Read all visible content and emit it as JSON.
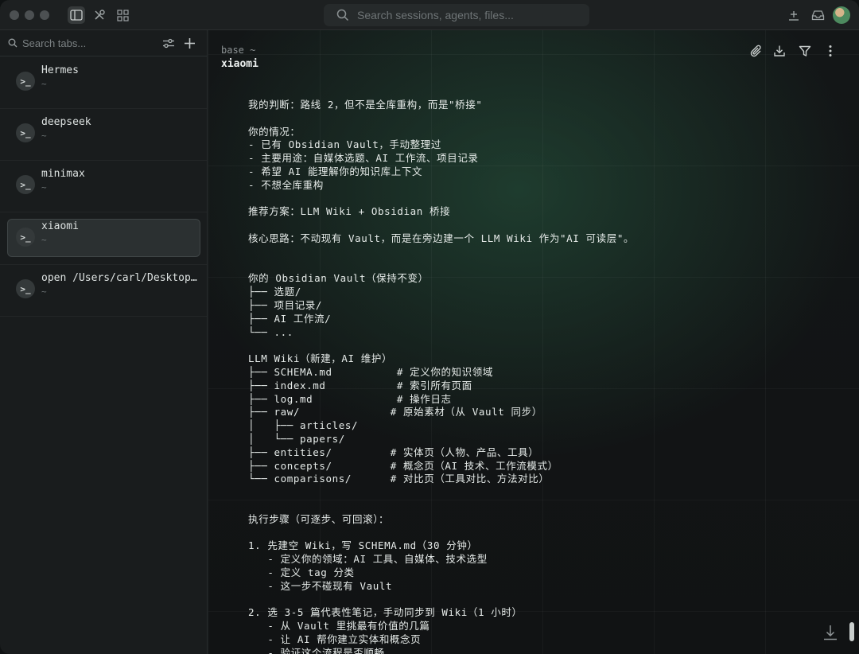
{
  "titlebar": {
    "search_placeholder": "Search sessions, agents, files..."
  },
  "sidebar": {
    "search_placeholder": "Search tabs...",
    "sessions": [
      {
        "name": "Hermes",
        "sub": "~",
        "icon": ">_"
      },
      {
        "name": "deepseek",
        "sub": "~",
        "icon": ">_"
      },
      {
        "name": "minimax",
        "sub": "~",
        "icon": ">_"
      },
      {
        "name": "xiaomi",
        "sub": "~",
        "icon": ">_",
        "active": true
      },
      {
        "name": "open /Users/carl/Desktop…",
        "sub": "~",
        "icon": ">_"
      }
    ]
  },
  "main": {
    "path": "base ~",
    "title": "xiaomi",
    "content_lines": [
      "我的判断：路线 2，但不是全库重构，而是\"桥接\"",
      "",
      "你的情况：",
      "- 已有 Obsidian Vault，手动整理过",
      "- 主要用途：自媒体选题、AI 工作流、项目记录",
      "- 希望 AI 能理解你的知识库上下文",
      "- 不想全库重构",
      "",
      "推荐方案：LLM Wiki + Obsidian 桥接",
      "",
      "核心思路：不动现有 Vault，而是在旁边建一个 LLM Wiki 作为\"AI 可读层\"。",
      "",
      "",
      "你的 Obsidian Vault（保持不变）",
      "├── 选题/",
      "├── 项目记录/",
      "├── AI 工作流/",
      "└── ...",
      "",
      "LLM Wiki（新建，AI 维护）",
      "├── SCHEMA.md          # 定义你的知识领域",
      "├── index.md           # 索引所有页面",
      "├── log.md             # 操作日志",
      "├── raw/              # 原始素材（从 Vault 同步）",
      "│   ├── articles/",
      "│   └── papers/",
      "├── entities/         # 实体页（人物、产品、工具）",
      "├── concepts/         # 概念页（AI 技术、工作流模式）",
      "└── comparisons/      # 对比页（工具对比、方法对比）",
      "",
      "",
      "执行步骤（可逐步、可回滚）：",
      "",
      "1. 先建空 Wiki，写 SCHEMA.md（30 分钟）",
      "   - 定义你的领域：AI 工具、自媒体、技术选型",
      "   - 定义 tag 分类",
      "   - 这一步不碰现有 Vault",
      "",
      "2. 选 3-5 篇代表性笔记，手动同步到 Wiki（1 小时）",
      "   - 从 Vault 里挑最有价值的几篇",
      "   - 让 AI 帮你建立实体和概念页",
      "   - 验证这个流程是否顺畅"
    ]
  },
  "colors": {
    "background": "#121516",
    "sidebar": "#191c1d",
    "accent_glow": "#285c42",
    "text": "#e6ebe9"
  },
  "icons": {
    "titlebar": [
      "sidebar-toggle-icon",
      "tools-icon",
      "grid-icon",
      "search-icon",
      "new-tab-icon",
      "inbox-icon"
    ],
    "header": [
      "attach-icon",
      "download-icon",
      "filter-icon",
      "more-icon"
    ]
  }
}
